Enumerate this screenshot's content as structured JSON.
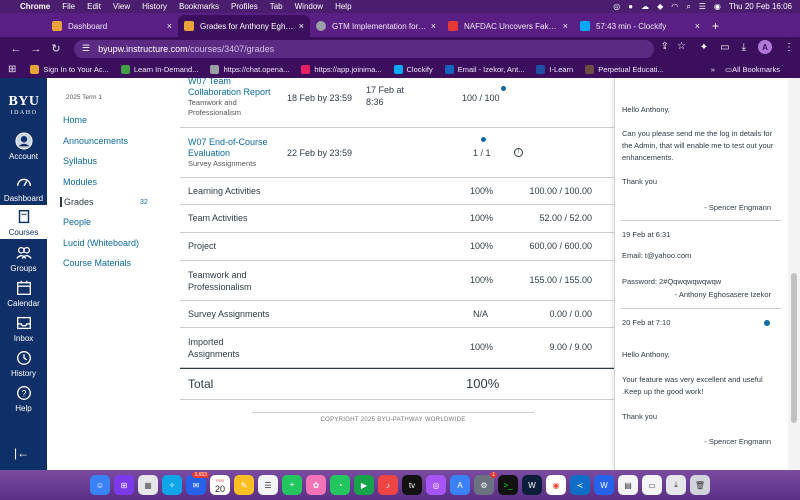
{
  "menubar": {
    "app": "Chrome",
    "items": [
      "File",
      "Edit",
      "View",
      "History",
      "Bookmarks",
      "Profiles",
      "Tab",
      "Window",
      "Help"
    ],
    "datetime": "Thu 20 Feb  16:06"
  },
  "tabs": [
    {
      "title": "Dashboard",
      "active": false,
      "icon_color": "#e8a33b",
      "icon": "canvas-icon"
    },
    {
      "title": "Grades for Anthony Eghosasere",
      "active": true,
      "icon_color": "#e8a33b",
      "icon": "canvas-icon"
    },
    {
      "title": "GTM Implementation for Reso",
      "active": false,
      "icon_color": "#9aa0a6",
      "icon": "chatgpt-icon"
    },
    {
      "title": "NAFDAC Uncovers Fake Drug",
      "active": false,
      "icon_color": "#e53935",
      "icon": "youtube-icon"
    },
    {
      "title": "57:43 min - Clockify",
      "active": false,
      "icon_color": "#03a9f4",
      "icon": "clockify-icon"
    }
  ],
  "toolbar": {
    "url_host": "byupw.instructure.com",
    "url_path": "/courses/3407/grades",
    "profile_initial": "A"
  },
  "bookmarks": {
    "items": [
      {
        "label": "Sign In to Your Ac...",
        "color": "#e8a33b"
      },
      {
        "label": "Learn In-Demand...",
        "color": "#43a047"
      },
      {
        "label": "https://chat.opena...",
        "color": "#9aa0a6"
      },
      {
        "label": "https://app.joinima...",
        "color": "#e91e63"
      },
      {
        "label": "Clockify",
        "color": "#03a9f4"
      },
      {
        "label": "Email - Izekor, Ant...",
        "color": "#1565c0"
      },
      {
        "label": "I-Learn",
        "color": "#1e4fa3"
      },
      {
        "label": "Perpetual Educati...",
        "color": "#6d4c41"
      }
    ],
    "all_label": "All Bookmarks"
  },
  "global_nav": {
    "brand_line1": "BYU",
    "brand_line2": "IDAHO",
    "items": [
      {
        "label": "Account",
        "icon": "account-icon"
      },
      {
        "label": "Dashboard",
        "icon": "dashboard-icon"
      },
      {
        "label": "Courses",
        "icon": "courses-icon",
        "active": true
      },
      {
        "label": "Groups",
        "icon": "groups-icon"
      },
      {
        "label": "Calendar",
        "icon": "calendar-icon"
      },
      {
        "label": "Inbox",
        "icon": "inbox-icon"
      },
      {
        "label": "History",
        "icon": "history-icon"
      },
      {
        "label": "Help",
        "icon": "help-icon"
      }
    ]
  },
  "course_nav": {
    "term": "2025 Term 1",
    "items": [
      {
        "label": "Home"
      },
      {
        "label": "Announcements"
      },
      {
        "label": "Syllabus"
      },
      {
        "label": "Modules"
      },
      {
        "label": "Grades",
        "active": true,
        "count": "32"
      },
      {
        "label": "People"
      },
      {
        "label": "Lucid (Whiteboard)"
      },
      {
        "label": "Course Materials"
      }
    ]
  },
  "assignments": [
    {
      "name": "W07 Team Collaboration Report",
      "group": "Teamwork and Professionalism",
      "due": "18 Feb by 23:59",
      "submitted": "17 Feb at 8:36",
      "score": "100 / 100",
      "unread_comment": true
    },
    {
      "name": "W07 End-of-Course Evaluation",
      "group": "Survey Assignments",
      "due": "22 Feb by 23:59",
      "submitted": "",
      "score": "1 / 1",
      "info_icon": true,
      "unread_comment": true
    }
  ],
  "groups": [
    {
      "name": "Learning Activities",
      "percent": "100%",
      "points": "100.00 / 100.00"
    },
    {
      "name": "Team Activities",
      "percent": "100%",
      "points": "52.00 / 52.00"
    },
    {
      "name": "Project",
      "percent": "100%",
      "points": "600.00 / 600.00"
    },
    {
      "name": "Teamwork and Professionalism",
      "percent": "100%",
      "points": "155.00 / 155.00"
    },
    {
      "name": "Survey Assignments",
      "percent": "N/A",
      "points": "0.00 / 0.00"
    },
    {
      "name": "Imported Assignments",
      "percent": "100%",
      "points": "9.00 / 9.00"
    }
  ],
  "total": {
    "label": "Total",
    "percent": "100%"
  },
  "footer": "COPYRIGHT 2025 BYU-PATHWAY WORLDWIDE",
  "comments": {
    "c1_greeting": "Hello Anthony,",
    "c1_body": "Can you please send me the log in details for the Admin, that will enable me to test out your enhancements.",
    "c1_thanks": "Thank you",
    "c1_sign": "- Spencer Engmann",
    "c2_date": "19 Feb at 6:31",
    "c2_email": "Email: t@yahoo.com",
    "c2_password": "Password: 2#Qqwqwqwqwqw",
    "c2_sign": "- Anthony Eghosasere Izekor",
    "c3_date": "20 Feb at 7:10",
    "c3_greeting": "Hello Anthony,",
    "c3_body": "Your feature was very excellent and useful .Keep up the good work!",
    "c3_thanks": "Thank you",
    "c3_sign": "- Spencer Engmann"
  },
  "dock": {
    "mail_badge": "3,653",
    "calendar_month": "FEB",
    "calendar_day": "20",
    "appstore_badge": "1"
  },
  "colors": {
    "chrome_frame": "#3c0f5e",
    "canvas_nav": "#0f2f68",
    "link": "#0b6aa2"
  }
}
